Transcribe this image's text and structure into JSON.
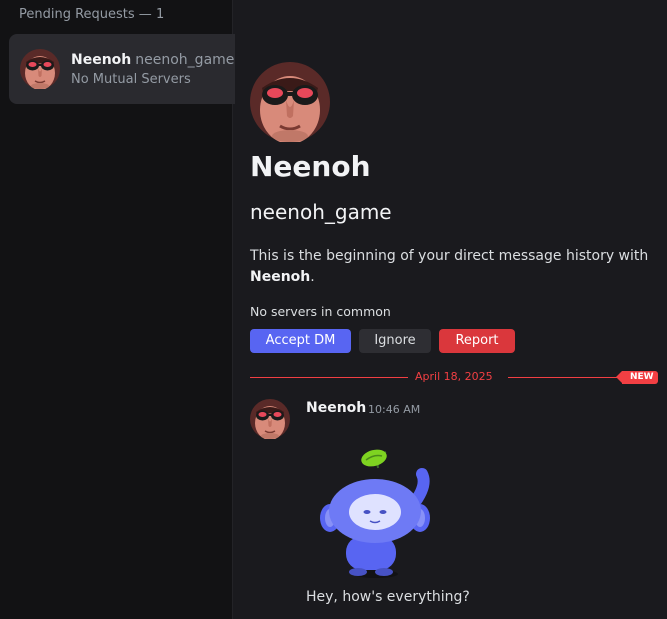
{
  "sidebar": {
    "pending_header": "Pending Requests — 1",
    "request": {
      "display_name": "Neenoh",
      "username": "neenoh_game",
      "subtitle": "No Mutual Servers"
    }
  },
  "profile": {
    "display_name": "Neenoh",
    "username": "neenoh_game",
    "intro_text": "This is the beginning of your direct message history with",
    "intro_name": "Neenoh",
    "intro_end": ".",
    "servers_text": "No servers in common"
  },
  "actions": {
    "accept_label": "Accept DM",
    "ignore_label": "Ignore",
    "report_label": "Report"
  },
  "divider": {
    "date": "April 18, 2025",
    "new_label": "NEW"
  },
  "message": {
    "author": "Neenoh",
    "time": "10:46 AM",
    "sticker": "wumpus-waving-sticker",
    "text": "Hey, how's everything?"
  },
  "colors": {
    "accent": "#5865f2",
    "danger": "#da373c",
    "new_line": "#f23f43",
    "background": "#1a1a1e",
    "sidebar": "#121214"
  }
}
